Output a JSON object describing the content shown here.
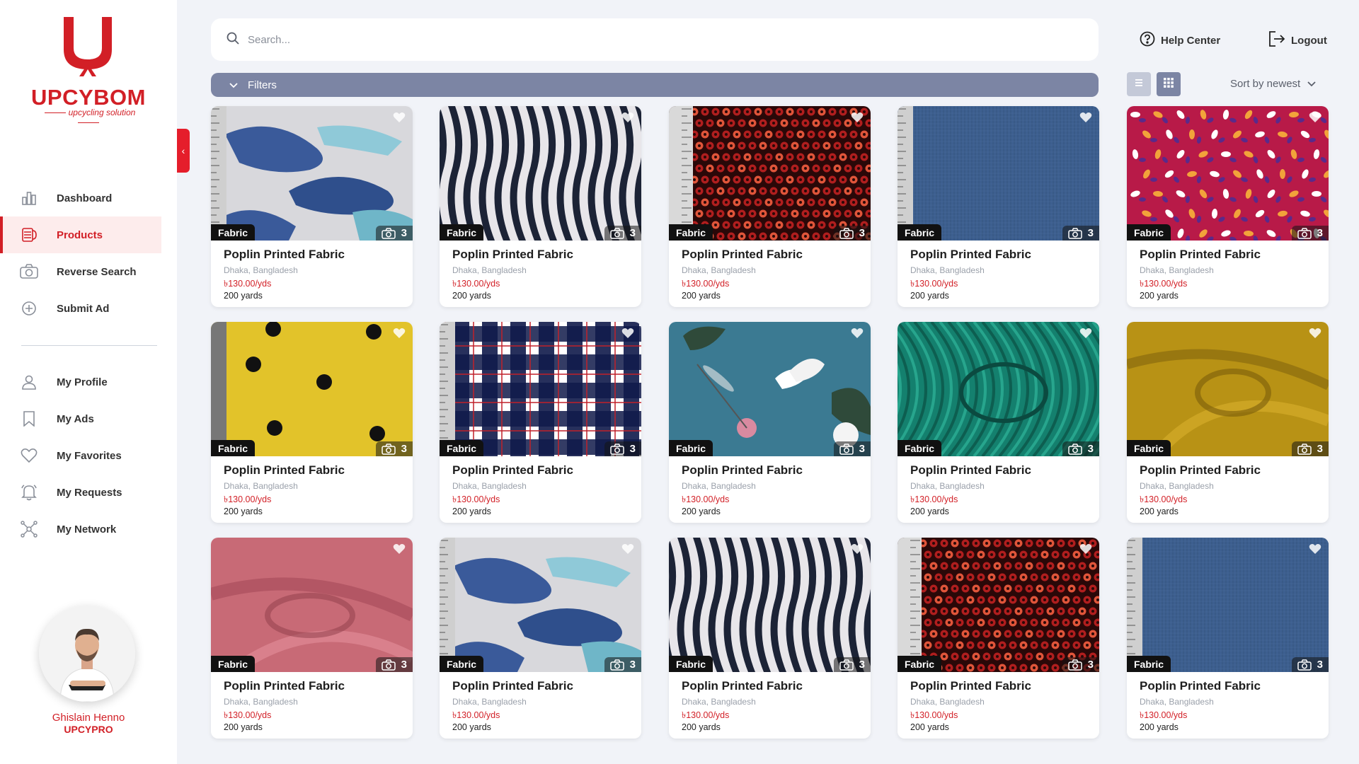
{
  "brand": {
    "name": "UPCYBOM",
    "tagline": "upcycling solution",
    "color": "#d21f26"
  },
  "search": {
    "placeholder": "Search...",
    "value": ""
  },
  "header": {
    "help_label": "Help Center",
    "logout_label": "Logout"
  },
  "filters": {
    "label": "Filters"
  },
  "sort": {
    "label": "Sort by newest"
  },
  "view": {
    "active": "grid"
  },
  "sidebar": {
    "primary": [
      {
        "label": "Dashboard",
        "icon": "chart-bar-icon",
        "active": false
      },
      {
        "label": "Products",
        "icon": "fabric-roll-icon",
        "active": true
      },
      {
        "label": "Reverse Search",
        "icon": "camera-icon",
        "active": false
      },
      {
        "label": "Submit Ad",
        "icon": "plus-circle-icon",
        "active": false
      }
    ],
    "secondary": [
      {
        "label": "My Profile",
        "icon": "user-icon"
      },
      {
        "label": "My Ads",
        "icon": "bookmark-icon"
      },
      {
        "label": "My Favorites",
        "icon": "heart-icon"
      },
      {
        "label": "My Requests",
        "icon": "bell-icon"
      },
      {
        "label": "My Network",
        "icon": "network-icon"
      }
    ]
  },
  "user": {
    "name": "Ghislain Henno",
    "org": "UPCYPRO"
  },
  "products": [
    {
      "title": "Poplin Printed Fabric",
      "location": "Dhaka, Bangladesh",
      "price": "৳130.00/yds",
      "quantity": "200 yards",
      "category": "Fabric",
      "photo_count": "3",
      "pattern": "whales"
    },
    {
      "title": "Poplin Printed Fabric",
      "location": "Dhaka, Bangladesh",
      "price": "৳130.00/yds",
      "quantity": "200 yards",
      "category": "Fabric",
      "photo_count": "3",
      "pattern": "zebra"
    },
    {
      "title": "Poplin Printed Fabric",
      "location": "Dhaka, Bangladesh",
      "price": "৳130.00/yds",
      "quantity": "200 yards",
      "category": "Fabric",
      "photo_count": "3",
      "pattern": "sequins"
    },
    {
      "title": "Poplin Printed Fabric",
      "location": "Dhaka, Bangladesh",
      "price": "৳130.00/yds",
      "quantity": "200 yards",
      "category": "Fabric",
      "photo_count": "3",
      "pattern": "denim"
    },
    {
      "title": "Poplin Printed Fabric",
      "location": "Dhaka, Bangladesh",
      "price": "৳130.00/yds",
      "quantity": "200 yards",
      "category": "Fabric",
      "photo_count": "3",
      "pattern": "floral-pink"
    },
    {
      "title": "Poplin Printed Fabric",
      "location": "Dhaka, Bangladesh",
      "price": "৳130.00/yds",
      "quantity": "200 yards",
      "category": "Fabric",
      "photo_count": "3",
      "pattern": "polka-yellow"
    },
    {
      "title": "Poplin Printed Fabric",
      "location": "Dhaka, Bangladesh",
      "price": "৳130.00/yds",
      "quantity": "200 yards",
      "category": "Fabric",
      "photo_count": "3",
      "pattern": "plaid"
    },
    {
      "title": "Poplin Printed Fabric",
      "location": "Dhaka, Bangladesh",
      "price": "৳130.00/yds",
      "quantity": "200 yards",
      "category": "Fabric",
      "photo_count": "3",
      "pattern": "dragonfly"
    },
    {
      "title": "Poplin Printed Fabric",
      "location": "Dhaka, Bangladesh",
      "price": "৳130.00/yds",
      "quantity": "200 yards",
      "category": "Fabric",
      "photo_count": "3",
      "pattern": "green-pleat"
    },
    {
      "title": "Poplin Printed Fabric",
      "location": "Dhaka, Bangladesh",
      "price": "৳130.00/yds",
      "quantity": "200 yards",
      "category": "Fabric",
      "photo_count": "3",
      "pattern": "mustard"
    },
    {
      "title": "Poplin Printed Fabric",
      "location": "Dhaka, Bangladesh",
      "price": "৳130.00/yds",
      "quantity": "200 yards",
      "category": "Fabric",
      "photo_count": "3",
      "pattern": "pink-silk"
    },
    {
      "title": "Poplin Printed Fabric",
      "location": "Dhaka, Bangladesh",
      "price": "৳130.00/yds",
      "quantity": "200 yards",
      "category": "Fabric",
      "photo_count": "3",
      "pattern": "whales"
    },
    {
      "title": "Poplin Printed Fabric",
      "location": "Dhaka, Bangladesh",
      "price": "৳130.00/yds",
      "quantity": "200 yards",
      "category": "Fabric",
      "photo_count": "3",
      "pattern": "zebra"
    },
    {
      "title": "Poplin Printed Fabric",
      "location": "Dhaka, Bangladesh",
      "price": "৳130.00/yds",
      "quantity": "200 yards",
      "category": "Fabric",
      "photo_count": "3",
      "pattern": "sequins"
    },
    {
      "title": "Poplin Printed Fabric",
      "location": "Dhaka, Bangladesh",
      "price": "৳130.00/yds",
      "quantity": "200 yards",
      "category": "Fabric",
      "photo_count": "3",
      "pattern": "denim"
    }
  ]
}
